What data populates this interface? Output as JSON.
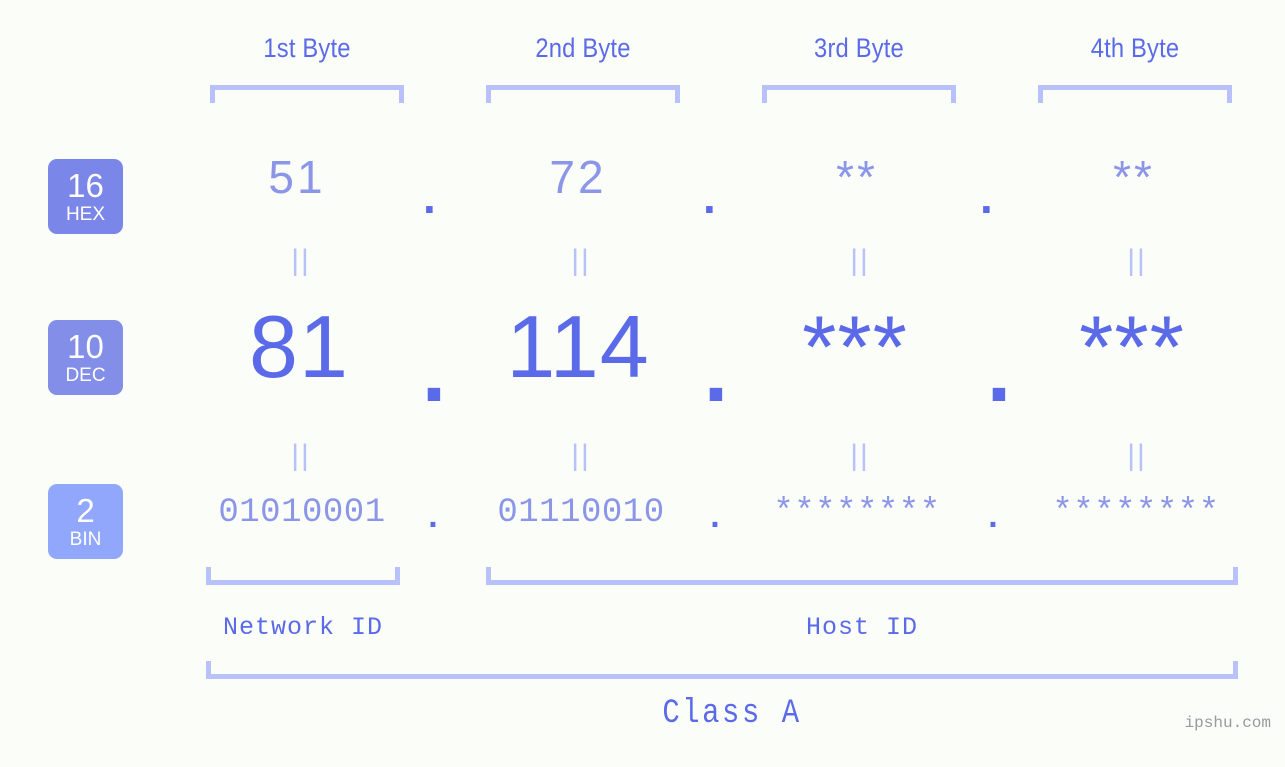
{
  "theme": {
    "background": "#fbfdf8",
    "accent_strong": "#5b6ae8",
    "accent_mid": "#8b96e8",
    "accent_light": "#b9c1fb",
    "badge_hex_bg": "#7b87e8",
    "badge_dec_bg": "#828ee8",
    "badge_bin_bg": "#90a7fb",
    "watermark_color": "#9a9a9a"
  },
  "byte_headers": [
    {
      "label": "1st Byte"
    },
    {
      "label": "2nd Byte"
    },
    {
      "label": "3rd Byte"
    },
    {
      "label": "4th Byte"
    }
  ],
  "base_badges": [
    {
      "number": "16",
      "name": "HEX"
    },
    {
      "number": "10",
      "name": "DEC"
    },
    {
      "number": "2",
      "name": "BIN"
    }
  ],
  "rows": {
    "hex": {
      "values": [
        "51",
        "72",
        "**",
        "**"
      ],
      "separator": "."
    },
    "dec": {
      "values": [
        "81",
        "114",
        "***",
        "***"
      ],
      "separator": "."
    },
    "bin": {
      "values": [
        "01010001",
        "01110010",
        "********",
        "********"
      ],
      "separator": "."
    }
  },
  "connectors": {
    "symbol": "||",
    "top_row_count": 4,
    "bottom_row_count": 4
  },
  "id_groups": [
    {
      "label": "Network ID"
    },
    {
      "label": "Host ID"
    }
  ],
  "class": {
    "label": "Class A"
  },
  "watermark": {
    "text": "ipshu.com"
  }
}
